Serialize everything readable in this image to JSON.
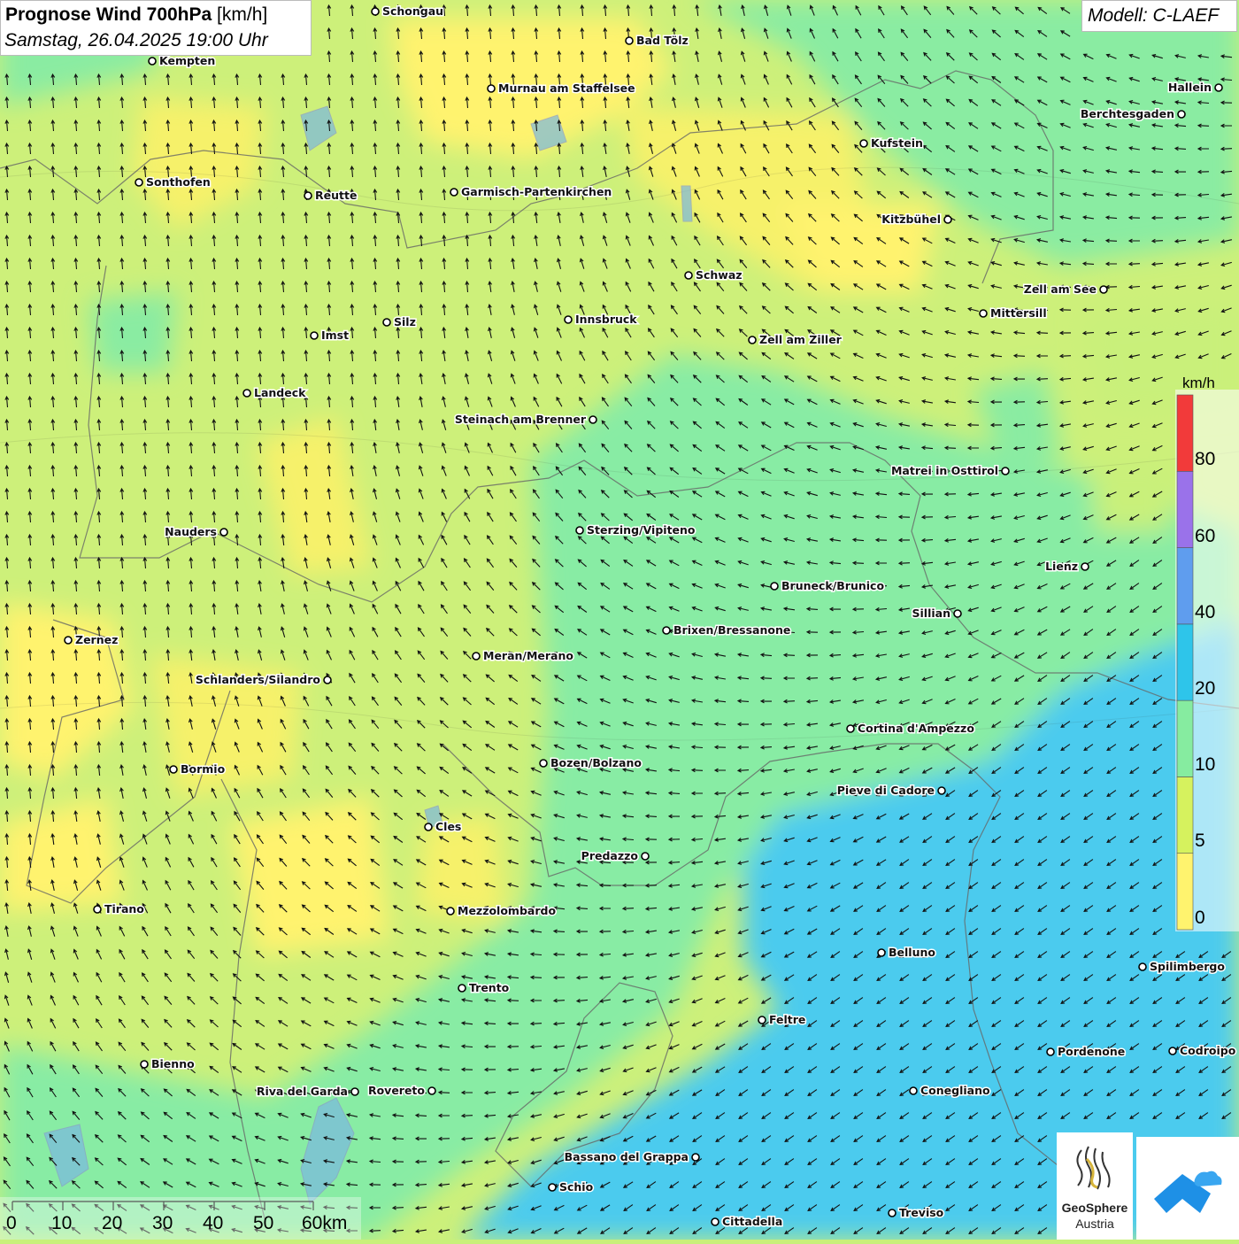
{
  "header": {
    "title_bold": "Prognose Wind 700hPa",
    "title_unit": "[km/h]",
    "subtitle": "Samstag, 26.04.2025 19:00 Uhr",
    "model": "Modell: C-LAEF"
  },
  "legend": {
    "unit": "km/h",
    "labels": [
      "80",
      "60",
      "40",
      "20",
      "10",
      "5",
      "0"
    ],
    "classes": [
      {
        "from": 0,
        "to": 5,
        "color": "#fff36e"
      },
      {
        "from": 5,
        "to": 10,
        "color": "#d6f25e"
      },
      {
        "from": 10,
        "to": 20,
        "color": "#86eca0"
      },
      {
        "from": 20,
        "to": 40,
        "color": "#2ec5ea"
      },
      {
        "from": 40,
        "to": 60,
        "color": "#5f9dee"
      },
      {
        "from": 60,
        "to": 80,
        "color": "#9a72ea"
      },
      {
        "from": 80,
        "to": 100,
        "color": "#f23a3a"
      }
    ]
  },
  "scale_bar": {
    "labels": [
      "0",
      "10",
      "20",
      "30",
      "40",
      "50",
      "60km"
    ]
  },
  "cities": [
    {
      "name": "Schongau"
    },
    {
      "name": "Bad Tölz"
    },
    {
      "name": "Kempten"
    },
    {
      "name": "Murnau am Staffelsee"
    },
    {
      "name": "Hallein"
    },
    {
      "name": "Berchtesgaden"
    },
    {
      "name": "Kufstein"
    },
    {
      "name": "Sonthofen"
    },
    {
      "name": "Reutte"
    },
    {
      "name": "Garmisch-Partenkirchen"
    },
    {
      "name": "Kitzbühel"
    },
    {
      "name": "Schwaz"
    },
    {
      "name": "Zell am See"
    },
    {
      "name": "Mittersill"
    },
    {
      "name": "Silz"
    },
    {
      "name": "Innsbruck"
    },
    {
      "name": "Imst"
    },
    {
      "name": "Zell am Ziller"
    },
    {
      "name": "Landeck"
    },
    {
      "name": "Steinach am Brenner"
    },
    {
      "name": "Matrei in Osttirol"
    },
    {
      "name": "Nauders"
    },
    {
      "name": "Sterzing/Vipiteno"
    },
    {
      "name": "Lienz"
    },
    {
      "name": "Bruneck/Brunico"
    },
    {
      "name": "Sillian"
    },
    {
      "name": "Zernez"
    },
    {
      "name": "Brixen/Bressanone"
    },
    {
      "name": "Meran/Merano"
    },
    {
      "name": "Schlanders/Silandro"
    },
    {
      "name": "Cortina d'Ampezzo"
    },
    {
      "name": "Bozen/Bolzano"
    },
    {
      "name": "Bormio"
    },
    {
      "name": "Pieve di Cadore"
    },
    {
      "name": "Cles"
    },
    {
      "name": "Predazzo"
    },
    {
      "name": "Tirano"
    },
    {
      "name": "Mezzolombardo"
    },
    {
      "name": "Belluno"
    },
    {
      "name": "Spilimbergo"
    },
    {
      "name": "Trento"
    },
    {
      "name": "Feltre"
    },
    {
      "name": "Pordenone"
    },
    {
      "name": "Codroipo"
    },
    {
      "name": "Bienno"
    },
    {
      "name": "Riva del Garda"
    },
    {
      "name": "Rovereto"
    },
    {
      "name": "Conegliano"
    },
    {
      "name": "Bassano del Grappa"
    },
    {
      "name": "Schio"
    },
    {
      "name": "Treviso"
    },
    {
      "name": "Cittadella"
    }
  ],
  "logos": {
    "geosphere_line1": "GeoSphere",
    "geosphere_line2": "Austria"
  }
}
